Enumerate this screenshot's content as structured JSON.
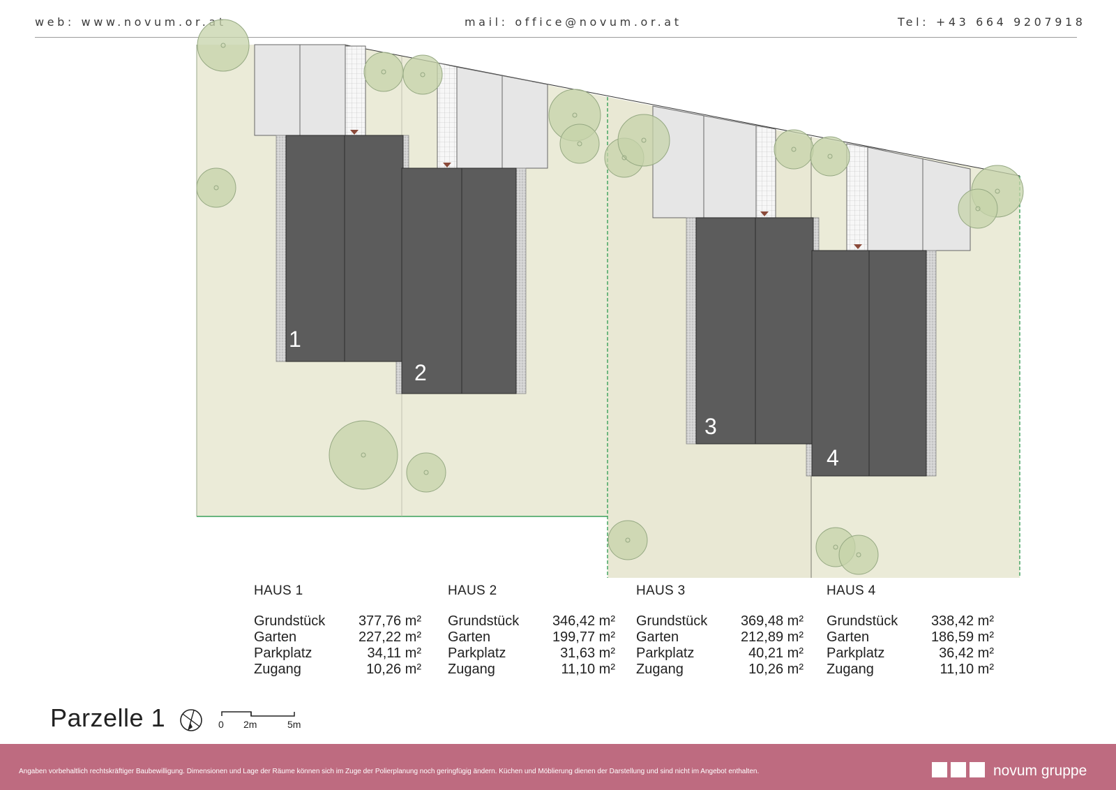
{
  "header": {
    "web": "web: www.novum.or.at",
    "mail": "mail: office@novum.or.at",
    "tel": "Tel: +43 664 9207918"
  },
  "plan": {
    "house_numbers": [
      "1",
      "2",
      "3",
      "4"
    ],
    "colors": {
      "garden": "#ebebd8",
      "roof": "#5c5c5c",
      "parking": "#e4e4e4",
      "tree": "#c6d3a9",
      "plot_line": "#3aa05a"
    }
  },
  "houses": [
    {
      "title": "HAUS 1",
      "rows": [
        {
          "label": "Grundstück",
          "value": "377,76 m²"
        },
        {
          "label": "Garten",
          "value": "227,22 m²"
        },
        {
          "label": "Parkplatz",
          "value": "34,11 m²"
        },
        {
          "label": "Zugang",
          "value": "10,26 m²"
        }
      ]
    },
    {
      "title": "HAUS 2",
      "rows": [
        {
          "label": "Grundstück",
          "value": "346,42 m²"
        },
        {
          "label": "Garten",
          "value": "199,77 m²"
        },
        {
          "label": "Parkplatz",
          "value": "31,63 m²"
        },
        {
          "label": "Zugang",
          "value": "11,10 m²"
        }
      ]
    },
    {
      "title": "HAUS 3",
      "rows": [
        {
          "label": "Grundstück",
          "value": "369,48 m²"
        },
        {
          "label": "Garten",
          "value": "212,89 m²"
        },
        {
          "label": "Parkplatz",
          "value": "40,21 m²"
        },
        {
          "label": "Zugang",
          "value": "10,26 m²"
        }
      ]
    },
    {
      "title": "HAUS 4",
      "rows": [
        {
          "label": "Grundstück",
          "value": "338,42 m²"
        },
        {
          "label": "Garten",
          "value": "186,59 m²"
        },
        {
          "label": "Parkplatz",
          "value": "36,42 m²"
        },
        {
          "label": "Zugang",
          "value": "11,10 m²"
        }
      ]
    }
  ],
  "legend": {
    "title": "Parzelle 1",
    "north_icon": "north-arrow-icon",
    "scale_labels": [
      "0",
      "2m",
      "5m"
    ]
  },
  "footer": {
    "disclaimer": "Angaben vorbehaltlich rechtskräftiger Baubewilligung. Dimensionen und Lage der Räume können sich im Zuge der Polierplanung noch geringfügig ändern. Küchen und Möblierung dienen der Darstellung und sind nicht im Angebot enthalten.",
    "logo_text": "novum gruppe",
    "bg_color": "#be6b80"
  }
}
